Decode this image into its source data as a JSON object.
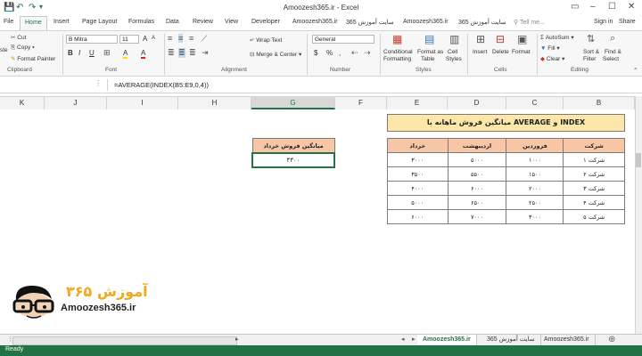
{
  "window": {
    "title": "Amoozesh365.ir - Excel"
  },
  "quick_access": {
    "save_icon": "save-icon",
    "undo_icon": "undo-icon",
    "redo_icon": "redo-icon"
  },
  "window_controls": {
    "minimize": "–",
    "maximize": "☐",
    "close": "✕",
    "ribbon_opts": "▭"
  },
  "tabs": [
    "File",
    "Home",
    "Insert",
    "Page Layout",
    "Formulas",
    "Data",
    "Review",
    "View",
    "Developer",
    "Amoozesh365.ir",
    "سایت آموزش 365",
    "Amoozesh365.ir",
    "سایت آموزش 365",
    "Tell me...",
    "Sign in",
    "Share"
  ],
  "ribbon": {
    "clipboard": {
      "cut": "Cut",
      "copy": "Copy",
      "format_painter": "Format Painter",
      "paste_tail": "ste",
      "group": "Clipboard"
    },
    "font": {
      "name": "B Mitra",
      "size": "11",
      "grow": "A",
      "shrink": "A",
      "bold": "B",
      "italic": "I",
      "underline": "U",
      "fill_color": "A",
      "font_color": "A",
      "group": "Font"
    },
    "alignment": {
      "wrap_text": "Wrap Text",
      "merge_center": "Merge & Center",
      "group": "Alignment"
    },
    "number": {
      "format": "General",
      "currency": "$",
      "percent": "%",
      "comma": ",",
      "group": "Number"
    },
    "styles": {
      "conditional": "Conditional",
      "conditional2": "Formatting",
      "format_as": "Format as",
      "format_as2": "Table",
      "cell": "Cell",
      "cell2": "Styles",
      "group": "Styles"
    },
    "cells": {
      "insert": "Insert",
      "delete": "Delete",
      "format": "Format",
      "group": "Cells"
    },
    "editing": {
      "autosum": "AutoSum",
      "fill": "Fill",
      "clear": "Clear",
      "sort": "Sort &",
      "sort2": "Filter",
      "find": "Find &",
      "find2": "Select",
      "group": "Editing"
    }
  },
  "formula_bar": {
    "formula": "=AVERAGE(INDEX(B5:E9,0,4))"
  },
  "columns": [
    "K",
    "J",
    "I",
    "H",
    "G",
    "F",
    "E",
    "D",
    "C",
    "B"
  ],
  "selected_column": "G",
  "main_table": {
    "title": "میانگین فروش ماهانه با AVERAGE و INDEX",
    "headers": [
      "خرداد",
      "اردیبهشت",
      "فروردین",
      "شرکت"
    ],
    "rows": [
      [
        "۳۰۰۰",
        "۵۰۰۰",
        "۱۰۰۰",
        "شرکت ۱"
      ],
      [
        "۳۵۰۰",
        "۵۵۰۰",
        "۱۵۰۰",
        "شرکت ۲"
      ],
      [
        "۴۰۰۰",
        "۶۰۰۰",
        "۲۰۰۰",
        "شرکت ۳"
      ],
      [
        "۵۰۰۰",
        "۶۵۰۰",
        "۲۵۰۰",
        "شرکت ۴"
      ],
      [
        "۶۰۰۰",
        "۷۰۰۰",
        "۳۰۰۰",
        "شرکت ۵"
      ]
    ]
  },
  "result_table": {
    "header": "میانگین فروش خرداد",
    "value": "۴۳۰۰"
  },
  "logo": {
    "fa_text": "آموزش ۳۶۵",
    "brand": "Amoozesh365.ir"
  },
  "sheet_tabs": [
    "Amoozesh365.ir",
    "سایت آموزش 365",
    "Amoozesh365.ir"
  ],
  "status": {
    "ready": "Ready"
  },
  "colors": {
    "excel_green": "#217346",
    "header_fill": "#f7c6a7",
    "title_fill": "#fde7a8",
    "logo_orange": "#f0a81c"
  }
}
